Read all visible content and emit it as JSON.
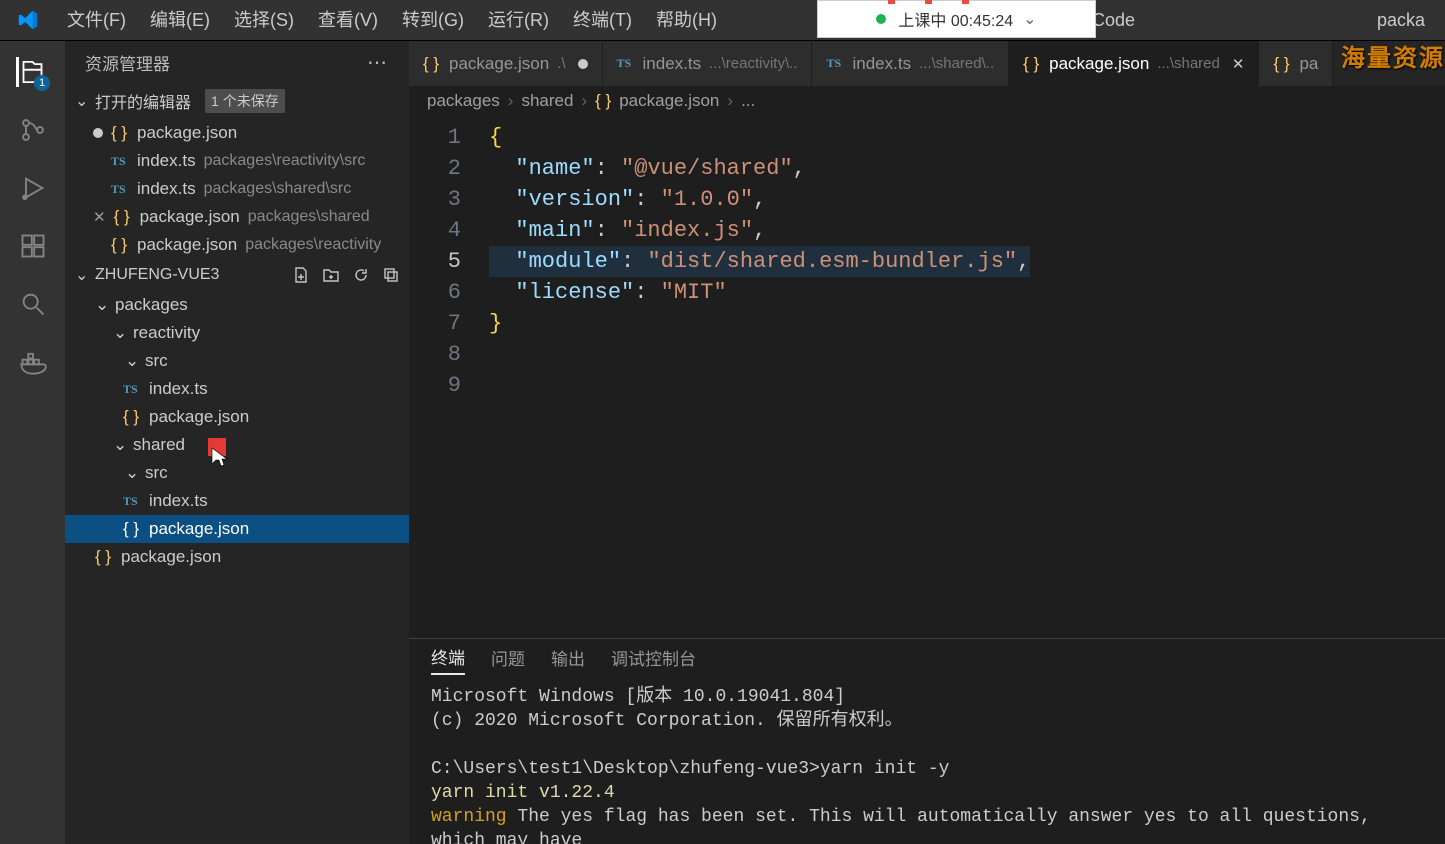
{
  "titlebar": {
    "menu": [
      "文件(F)",
      "编辑(E)",
      "选择(S)",
      "查看(V)",
      "转到(G)",
      "运行(R)",
      "终端(T)",
      "帮助(H)"
    ],
    "title_left": "packa",
    "title_right": "Code"
  },
  "floating": {
    "status": "上课中 00:45:24"
  },
  "watermark": "海量资源",
  "activity": {
    "badge_files": "1"
  },
  "sidebar": {
    "title": "资源管理器",
    "open_editors_label": "打开的编辑器",
    "open_editors_badge": "1 个未保存",
    "open_editors": [
      {
        "file": "package.json",
        "path": "",
        "unsaved": true,
        "type": "json"
      },
      {
        "file": "index.ts",
        "path": "packages\\reactivity\\src",
        "type": "ts"
      },
      {
        "file": "index.ts",
        "path": "packages\\shared\\src",
        "type": "ts"
      },
      {
        "file": "package.json",
        "path": "packages\\shared",
        "type": "json",
        "closable": true
      },
      {
        "file": "package.json",
        "path": "packages\\reactivity",
        "type": "json"
      }
    ],
    "project": "ZHUFENG-VUE3",
    "tree": {
      "packages": {
        "reactivity": {
          "src": [
            "index.ts"
          ],
          "files": [
            "package.json"
          ]
        },
        "shared": {
          "src": [
            "index.ts"
          ],
          "files": [
            "package.json"
          ]
        }
      },
      "root_files": [
        "package.json"
      ]
    }
  },
  "tabs": [
    {
      "file": "package.json",
      "path": ".\\",
      "type": "json",
      "unsaved": true
    },
    {
      "file": "index.ts",
      "path": "...\\reactivity\\..",
      "type": "ts"
    },
    {
      "file": "index.ts",
      "path": "...\\shared\\..",
      "type": "ts"
    },
    {
      "file": "package.json",
      "path": "...\\shared",
      "type": "json",
      "active": true
    },
    {
      "file": "pa",
      "path": "",
      "type": "json",
      "cut": true
    }
  ],
  "breadcrumbs": [
    "packages",
    "shared",
    "package.json",
    "..."
  ],
  "code": {
    "lines": [
      "{",
      "  \"name\": \"@vue/shared\",",
      "  \"version\": \"1.0.0\",",
      "  \"main\": \"index.js\",",
      "  \"module\": \"dist/shared.esm-bundler.js\",",
      "  \"license\": \"MIT\"",
      "}",
      "",
      ""
    ],
    "active_line": 5
  },
  "panel": {
    "tabs": [
      "终端",
      "问题",
      "输出",
      "调试控制台"
    ],
    "active_tab": "终端",
    "terminal": {
      "l1": "Microsoft Windows [版本 10.0.19041.804]",
      "l2": "(c) 2020 Microsoft Corporation. 保留所有权利。",
      "l3": "C:\\Users\\test1\\Desktop\\zhufeng-vue3>yarn init -y",
      "l4": "yarn init v1.22.4",
      "l5_warn": "warning",
      "l5_rest": " The yes flag has been set. This will automatically answer yes to all questions, which may have"
    }
  }
}
